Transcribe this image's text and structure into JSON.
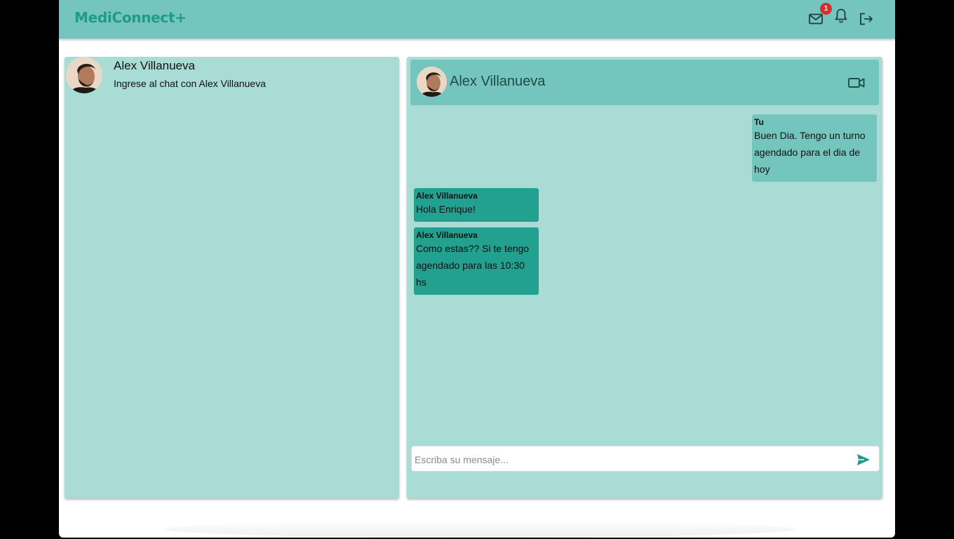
{
  "app": {
    "logo_text": "MediConnect+",
    "mail_badge_count": "1",
    "icons": {
      "mail": "mail-icon",
      "bell": "bell-icon",
      "logout": "logout-icon"
    }
  },
  "colors": {
    "topbar": "#74c5bd",
    "panel": "#a8dcd5",
    "outgoing_bubble": "#74c5bd",
    "incoming_bubble": "#22a090",
    "accent": "#1f9a8b",
    "badge": "#d32f2f"
  },
  "contacts": [
    {
      "name": "Alex Villanueva",
      "preview": "Ingrese al chat con Alex Villanueva"
    }
  ],
  "chat": {
    "header_name": "Alex Villanueva",
    "video_icon": "video-camera-icon",
    "messages": [
      {
        "author": "Tu",
        "text": "Buen Dia. Tengo un turno agendado para el dia de hoy",
        "direction": "outgoing"
      },
      {
        "author": "Alex Villanueva",
        "text": "Hola Enrique!",
        "direction": "incoming"
      },
      {
        "author": "Alex Villanueva",
        "text": "Como estas?? Si te tengo agendado para las 10:30 hs",
        "direction": "incoming"
      }
    ],
    "input": {
      "value": "",
      "placeholder": "Escriba su mensaje..."
    },
    "send_icon": "send-icon"
  }
}
